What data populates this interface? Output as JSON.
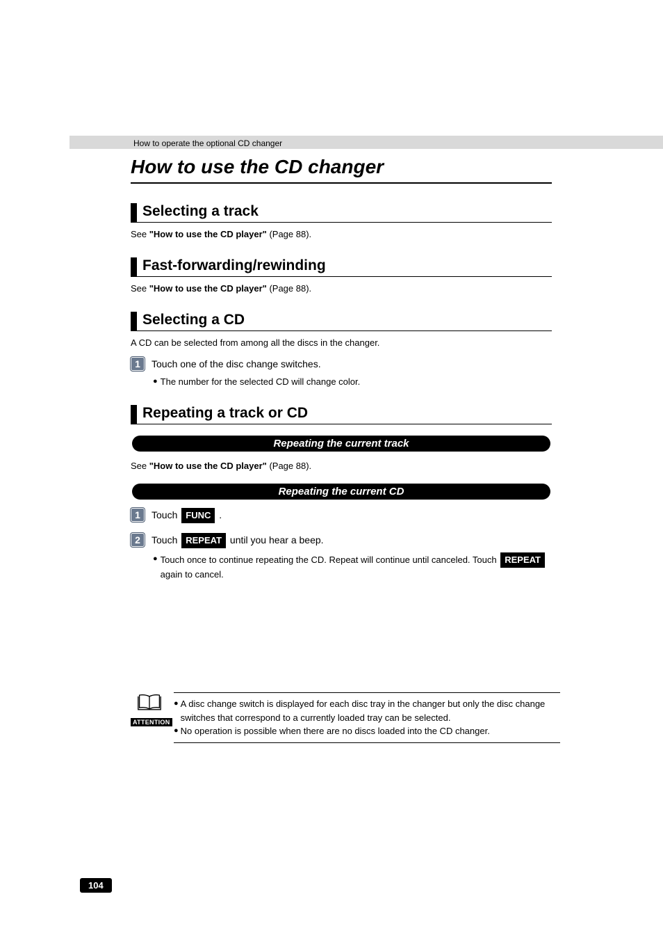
{
  "breadcrumb": "How to operate the optional CD changer",
  "title": "How to use the CD changer",
  "sections": {
    "select_track": {
      "heading": "Selecting a track",
      "see_prefix": "See ",
      "see_bold": "\"How to use the CD player\"",
      "see_suffix": " (Page 88)."
    },
    "ff_rw": {
      "heading": "Fast-forwarding/rewinding",
      "see_prefix": "See ",
      "see_bold": "\"How to use the CD player\"",
      "see_suffix": " (Page 88)."
    },
    "select_cd": {
      "heading": "Selecting a CD",
      "intro": "A CD can be selected from among all the discs in the changer.",
      "step1_num": "1",
      "step1_text": "Touch one of the disc change switches.",
      "step1_bullet": "The number for the selected CD will change color."
    },
    "repeat": {
      "heading": "Repeating a track or CD",
      "sub1_title": "Repeating the current track",
      "sub1_see_prefix": "See ",
      "sub1_see_bold": "\"How to use the CD player\"",
      "sub1_see_suffix": " (Page 88).",
      "sub2_title": "Repeating the current CD",
      "sub2_step1_num": "1",
      "sub2_step1_prefix": "Touch ",
      "sub2_step1_btn": "FUNC",
      "sub2_step1_suffix": " .",
      "sub2_step2_num": "2",
      "sub2_step2_prefix": "Touch ",
      "sub2_step2_btn": "REPEAT",
      "sub2_step2_suffix": " until you hear a beep.",
      "sub2_step2_bullet_prefix": "Touch once to continue repeating the CD. Repeat will continue until canceled. Touch ",
      "sub2_step2_bullet_btn": "REPEAT",
      "sub2_step2_bullet_suffix": " again to cancel."
    }
  },
  "attention": {
    "label": "ATTENTION",
    "b1": "A disc change switch is displayed for each disc tray in the changer but only the disc change switches that correspond to a currently loaded tray can be selected.",
    "b2": "No operation is possible when there are no discs loaded into the CD changer."
  },
  "page_number": "104"
}
